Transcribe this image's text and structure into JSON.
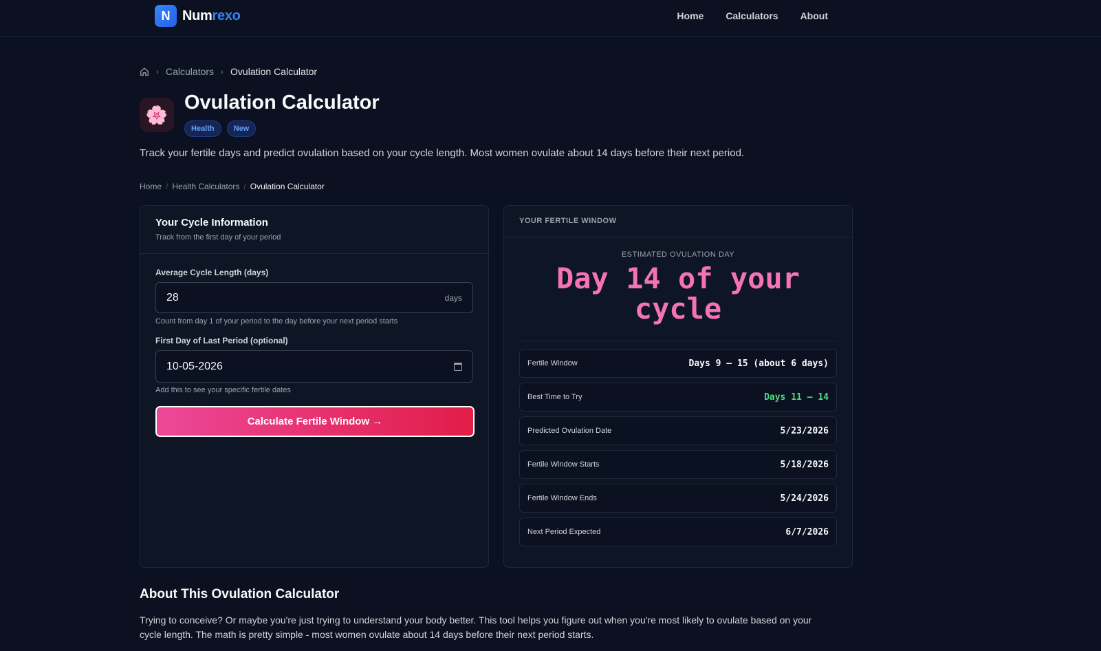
{
  "header": {
    "logo_letter": "N",
    "logo_part1": "Num",
    "logo_part2": "rexo",
    "nav": [
      "Home",
      "Calculators",
      "About"
    ]
  },
  "breadcrumb_top": {
    "items": [
      "Calculators",
      "Ovulation Calculator"
    ]
  },
  "page": {
    "icon": "🌸",
    "title": "Ovulation Calculator",
    "badges": [
      "Health",
      "New"
    ],
    "description": "Track your fertile days and predict ovulation based on your cycle length. Most women ovulate about 14 days before their next period."
  },
  "breadcrumb_secondary": {
    "items": [
      "Home",
      "Health Calculators",
      "Ovulation Calculator"
    ]
  },
  "form": {
    "title": "Your Cycle Information",
    "subtitle": "Track from the first day of your period",
    "cycle_label": "Average Cycle Length (days)",
    "cycle_value": "28",
    "cycle_suffix": "days",
    "cycle_hint": "Count from day 1 of your period to the day before your next period starts",
    "period_label": "First Day of Last Period (optional)",
    "period_value": "10-05-2026",
    "period_hint": "Add this to see your specific fertile dates",
    "button_label": "Calculate Fertile Window →"
  },
  "results": {
    "title": "YOUR FERTILE WINDOW",
    "ovulation_label": "ESTIMATED OVULATION DAY",
    "ovulation_value": "Day 14 of your cycle",
    "rows": [
      {
        "label": "Fertile Window",
        "value": "Days 9 – 15 (about 6 days)"
      },
      {
        "label": "Best Time to Try",
        "value": "Days 11 – 14"
      },
      {
        "label": "Predicted Ovulation Date",
        "value": "5/23/2026"
      },
      {
        "label": "Fertile Window Starts",
        "value": "5/18/2026"
      },
      {
        "label": "Fertile Window Ends",
        "value": "5/24/2026"
      },
      {
        "label": "Next Period Expected",
        "value": "6/7/2026"
      }
    ],
    "accent_color": "#f472b6",
    "highlight_color": "#4ade80"
  },
  "about": {
    "title": "About This Ovulation Calculator",
    "text": "Trying to conceive? Or maybe you're just trying to understand your body better. This tool helps you figure out when you're most likely to ovulate based on your cycle length. The math is pretty simple - most women ovulate about 14 days before their next period starts."
  }
}
